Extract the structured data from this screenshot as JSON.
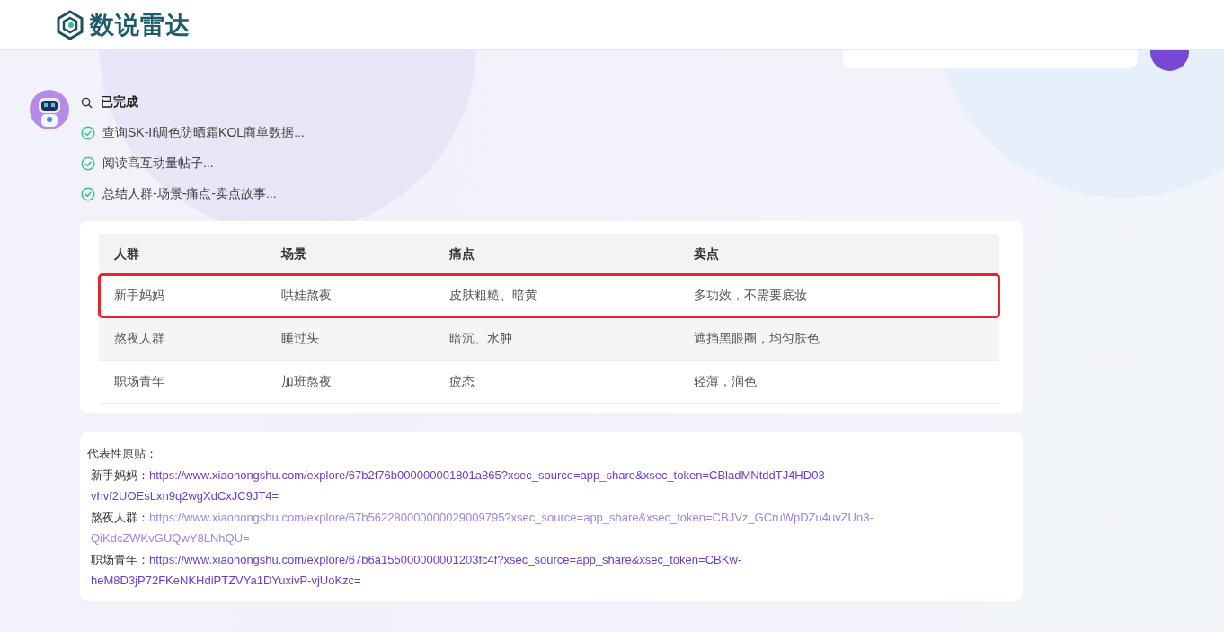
{
  "header": {
    "logo_text": "数说雷达"
  },
  "status": {
    "title": "已完成",
    "steps": [
      {
        "text": "查询SK-II调色防晒霜KOL商单数据...",
        "done": true
      },
      {
        "text": "阅读高互动量帖子...",
        "done": true
      },
      {
        "text": "总结人群-场景-痛点-卖点故事...",
        "done": true
      }
    ]
  },
  "table": {
    "columns": [
      "人群",
      "场景",
      "痛点",
      "卖点"
    ],
    "rows": [
      {
        "cells": [
          "新手妈妈",
          "哄娃熬夜",
          "皮肤粗糙、暗黄",
          "多功效，不需要底妆"
        ],
        "highlighted": true
      },
      {
        "cells": [
          "熬夜人群",
          "睡过头",
          "暗沉、水肿",
          "遮挡黑眼圈，均匀肤色"
        ],
        "highlighted": false
      },
      {
        "cells": [
          "职场青年",
          "加班熬夜",
          "疲态",
          "轻薄，润色"
        ],
        "highlighted": false
      }
    ]
  },
  "posts": {
    "title": "代表性原贴：",
    "links": [
      {
        "label": "新手妈妈：",
        "url_lines": [
          "https://www.xiaohongshu.com/explore/67b2f76b000000001801a865?xsec_source=app_share&xsec_token=CBladMNtddTJ4HD03-",
          "vhvf2UOEsLxn9q2wgXdCxJC9JT4="
        ],
        "hovered": false
      },
      {
        "label": "熬夜人群：",
        "url_lines": [
          "https://www.xiaohongshu.com/explore/67b562280000000029009795?xsec_source=app_share&xsec_token=CBJVz_GCruWpDZu4uvZUn3-",
          "QiKdcZWKvGUQwY8LNhQU="
        ],
        "hovered": true
      },
      {
        "label": "职场青年：",
        "url_lines": [
          "https://www.xiaohongshu.com/explore/67b6a155000000001203fc4f?xsec_source=app_share&xsec_token=CBKw-",
          "heM8D3jP72FKeNKHdiPTZVYa1DYuxivP-vjUoKzc="
        ],
        "hovered": false
      }
    ]
  }
}
